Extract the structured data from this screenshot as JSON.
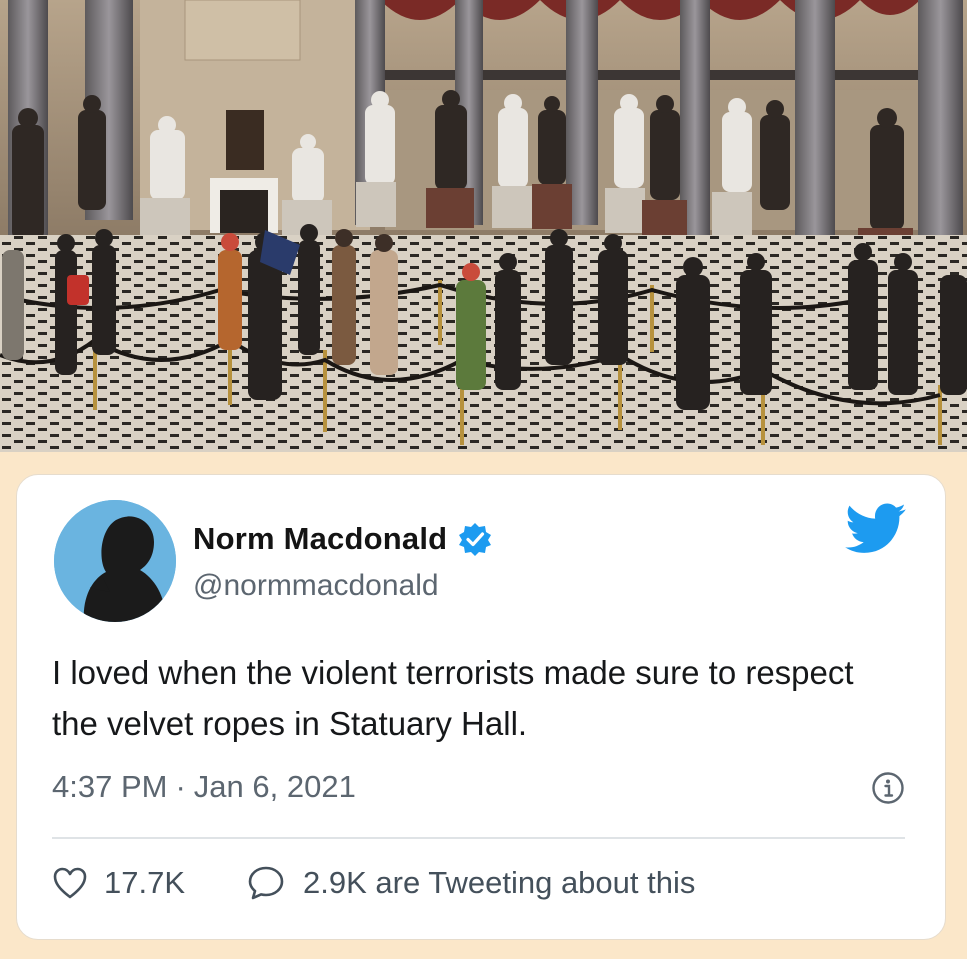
{
  "photo": {
    "subject": "Statuary Hall"
  },
  "tweet": {
    "display_name": "Norm Macdonald",
    "handle": "@normmacdonald",
    "verified": true,
    "text": "I loved when the violent terrorists made sure to respect the velvet ropes in Statuary Hall.",
    "time": "4:37 PM",
    "separator": "·",
    "date": "Jan 6, 2021",
    "like_count": "17.7K",
    "reply_text": "2.9K are Tweeting about this"
  },
  "icons": {
    "brand": "twitter-bird-icon",
    "verified": "verified-badge-icon",
    "info": "info-icon",
    "like": "heart-icon",
    "reply": "speech-bubble-icon"
  },
  "colors": {
    "background": "#fbe7c9",
    "brand_blue": "#1d9bf0",
    "text": "#16181a",
    "muted": "#5c6670"
  }
}
